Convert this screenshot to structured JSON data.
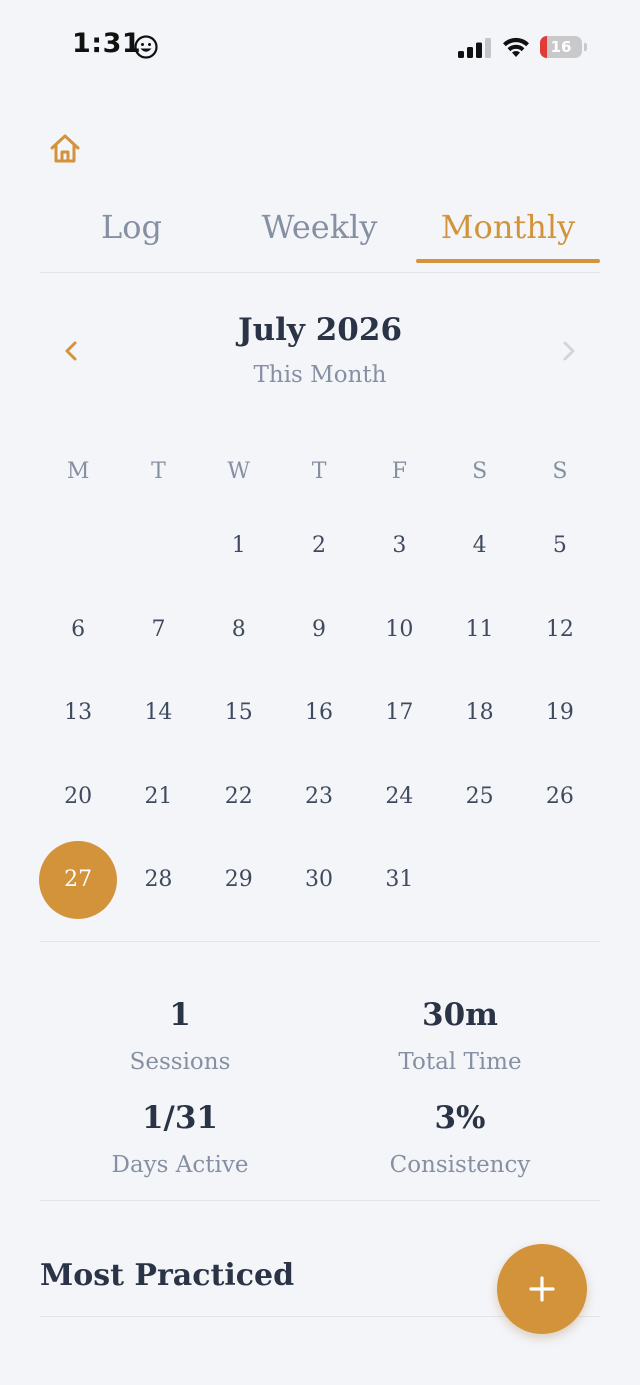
{
  "status_bar": {
    "time": "1:31",
    "battery": {
      "percent": 16,
      "label": "16"
    }
  },
  "tabs": [
    {
      "label": "Log",
      "active": false
    },
    {
      "label": "Weekly",
      "active": false
    },
    {
      "label": "Monthly",
      "active": true
    }
  ],
  "month_nav": {
    "title": "July 2026",
    "subtitle": "This Month"
  },
  "calendar": {
    "weekdays": [
      "M",
      "T",
      "W",
      "T",
      "F",
      "S",
      "S"
    ],
    "leading_blank_days": 2,
    "days": [
      "1",
      "2",
      "3",
      "4",
      "5",
      "6",
      "7",
      "8",
      "9",
      "10",
      "11",
      "12",
      "13",
      "14",
      "15",
      "16",
      "17",
      "18",
      "19",
      "20",
      "21",
      "22",
      "23",
      "24",
      "25",
      "26",
      "27",
      "28",
      "29",
      "30",
      "31"
    ],
    "selected_day": "27"
  },
  "stats": {
    "sessions": {
      "value": "1",
      "label": "Sessions"
    },
    "total_time": {
      "value": "30m",
      "label": "Total Time"
    },
    "days_active": {
      "value": "1/31",
      "label": "Days Active"
    },
    "consistency": {
      "value": "3%",
      "label": "Consistency"
    }
  },
  "most_practiced": {
    "title": "Most Practiced"
  },
  "icons": {
    "home": "home-icon",
    "prev": "chevron-left-icon",
    "next": "chevron-right-icon",
    "fab": "plus-icon"
  },
  "colors": {
    "accent": "#d2933a",
    "text_primary": "#2b3446",
    "text_muted": "#8690a3",
    "background": "#f4f5f9"
  }
}
